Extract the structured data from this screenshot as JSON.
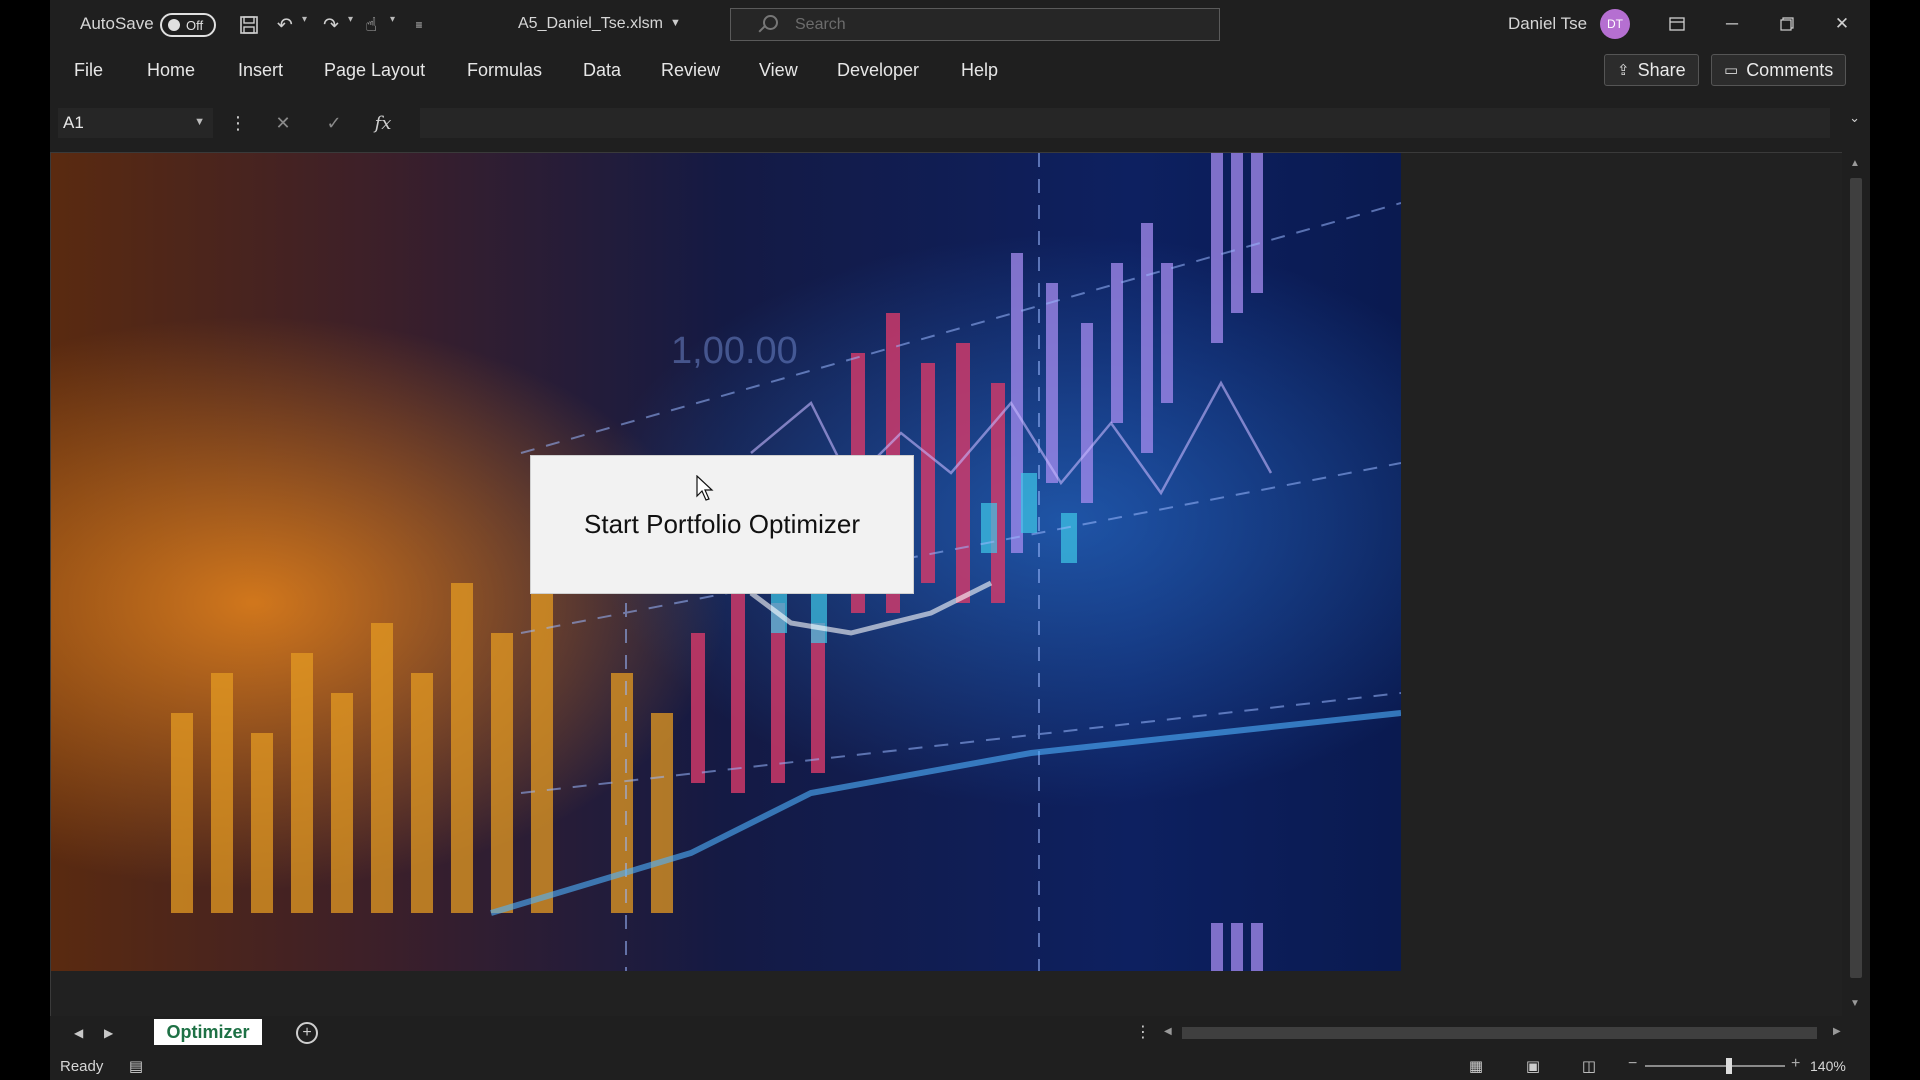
{
  "titlebar": {
    "autosave_label": "AutoSave",
    "autosave_state": "Off",
    "filename": "A5_Daniel_Tse.xlsm",
    "search_placeholder": "Search",
    "username": "Daniel Tse",
    "avatar_initials": "DT"
  },
  "menu": {
    "items": [
      "File",
      "Home",
      "Insert",
      "Page Layout",
      "Formulas",
      "Data",
      "Review",
      "View",
      "Developer",
      "Help"
    ],
    "share_label": "Share",
    "comments_label": "Comments"
  },
  "formula_bar": {
    "name_box": "A1",
    "formula": ""
  },
  "sheet": {
    "background_image": "financial-chart-image",
    "chart_overlay_text": "1,00.00",
    "button_label": "Start Portfolio Optimizer"
  },
  "tabs": {
    "active_sheet": "Optimizer"
  },
  "status": {
    "text": "Ready",
    "zoom": "140%"
  },
  "colors": {
    "background": "#1f1f1f",
    "avatar": "#b56fd1",
    "sheet_tab_text": "#1e7145"
  }
}
